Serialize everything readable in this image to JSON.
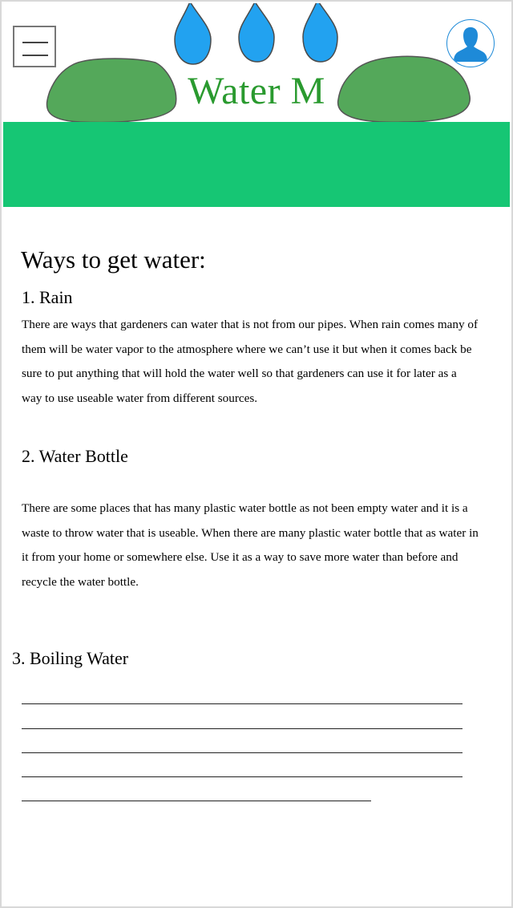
{
  "header": {
    "title": "Water M",
    "menu_icon": "hamburger-menu-icon",
    "avatar_icon": "user-avatar-icon",
    "colors": {
      "title": "#2a9a2f",
      "drop": "#22a2f0",
      "bush": "#54a85a",
      "banner": "#16c674",
      "avatar": "#1e8ad8"
    }
  },
  "main": {
    "heading": "Ways to get water:",
    "sections": [
      {
        "title": "1. Rain",
        "body": "There are ways that gardeners can water that is not from our pipes. When rain comes many of them will be water vapor to the atmosphere where we can’t use it but when it comes back be sure to put anything that will hold the water well so that gardeners can use it for later as a way to use useable water from different sources."
      },
      {
        "title": "2. Water Bottle",
        "body": "There are some places that has many plastic water bottle as not been empty water and it is a waste to throw water that is useable. When there are many plastic water bottle that as water in it from your home or somewhere else. Use it as a way to save more water than before and recycle the water bottle."
      },
      {
        "title": "3. Boiling Water",
        "body": ""
      }
    ]
  }
}
